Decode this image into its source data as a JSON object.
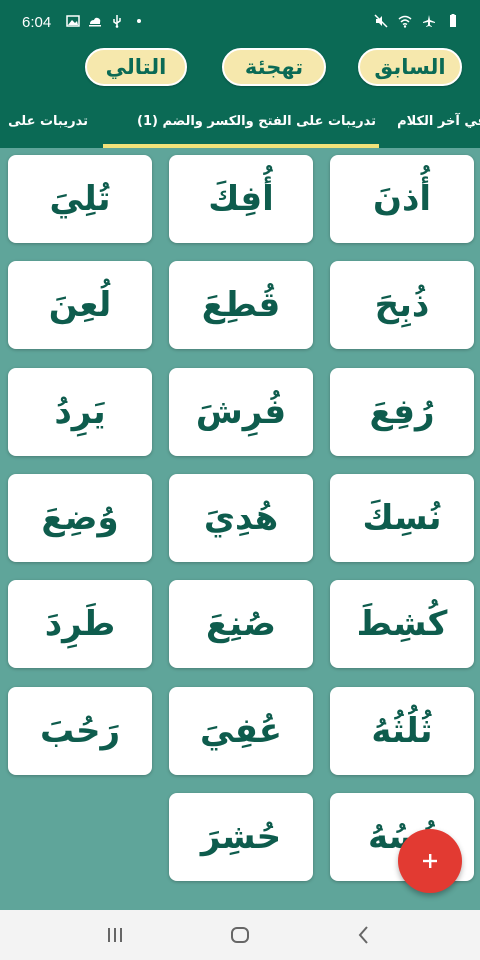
{
  "status_bar": {
    "time": "6:04",
    "left_icons": [
      "image-icon",
      "weather-icon",
      "usb-icon",
      "dot-icon"
    ],
    "right_icons": [
      "mute-icon",
      "wifi-icon",
      "airplane-icon",
      "battery-icon"
    ]
  },
  "toolbar": {
    "prev_label": "السابق",
    "spell_label": "تهجئة",
    "next_label": "التالي"
  },
  "tabs": [
    {
      "label": "في آخر الكلام",
      "active": false
    },
    {
      "label": "تدريبات على الفتح والكسر والضم (1)",
      "active": true
    },
    {
      "label": "تدريبات على",
      "active": false
    }
  ],
  "colors": {
    "header": "#0b6a55",
    "background": "#5fa59a",
    "button": "#f6e8ad",
    "tab_indicator": "#f2e27a",
    "word_text": "#0e5c4d",
    "fab": "#e23a32"
  },
  "words": [
    "أُذنَ",
    "أُفِكَ",
    "تُلِيَ",
    "ذُبِحَ",
    "قُطِعَ",
    "لُعِنَ",
    "رُفِعَ",
    "فُرِشَ",
    "يَرِدُ",
    "نُسِكَ",
    "هُدِيَ",
    "وُضِعَ",
    "كُشِطَ",
    "صُنِعَ",
    "طَرِدَ",
    "ثُلُثُهُ",
    "عُفِيَ",
    "رَحُبَ",
    "نُسُهُ",
    "حُشِرَ"
  ],
  "fab": {
    "icon": "plus-icon"
  },
  "system_nav": [
    "recent-apps-icon",
    "home-icon",
    "back-icon"
  ]
}
